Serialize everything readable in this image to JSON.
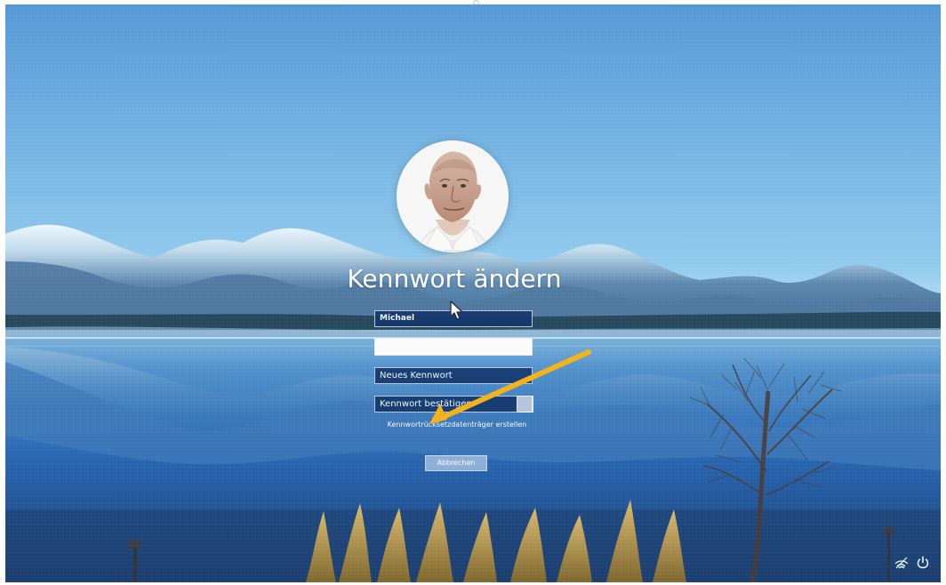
{
  "screen": {
    "title": "Kennwort ändern"
  },
  "form": {
    "username": "Michael",
    "current_password_value": "",
    "new_password_placeholder": "Neues Kennwort",
    "confirm_password_placeholder": "Kennwort bestätigen",
    "reset_link": "Kennwortrücksetzdatenträger erstellen",
    "cancel_label": "Abbrechen"
  },
  "icons": {
    "avatar": "user-avatar",
    "cursor": "mouse-pointer-icon",
    "annotation": "orange-arrow-icon",
    "network": "network-icon",
    "power": "power-icon"
  },
  "colors": {
    "annotation_arrow": "#f4b21b",
    "input_fill": "#153870",
    "text": "#ffffff"
  }
}
